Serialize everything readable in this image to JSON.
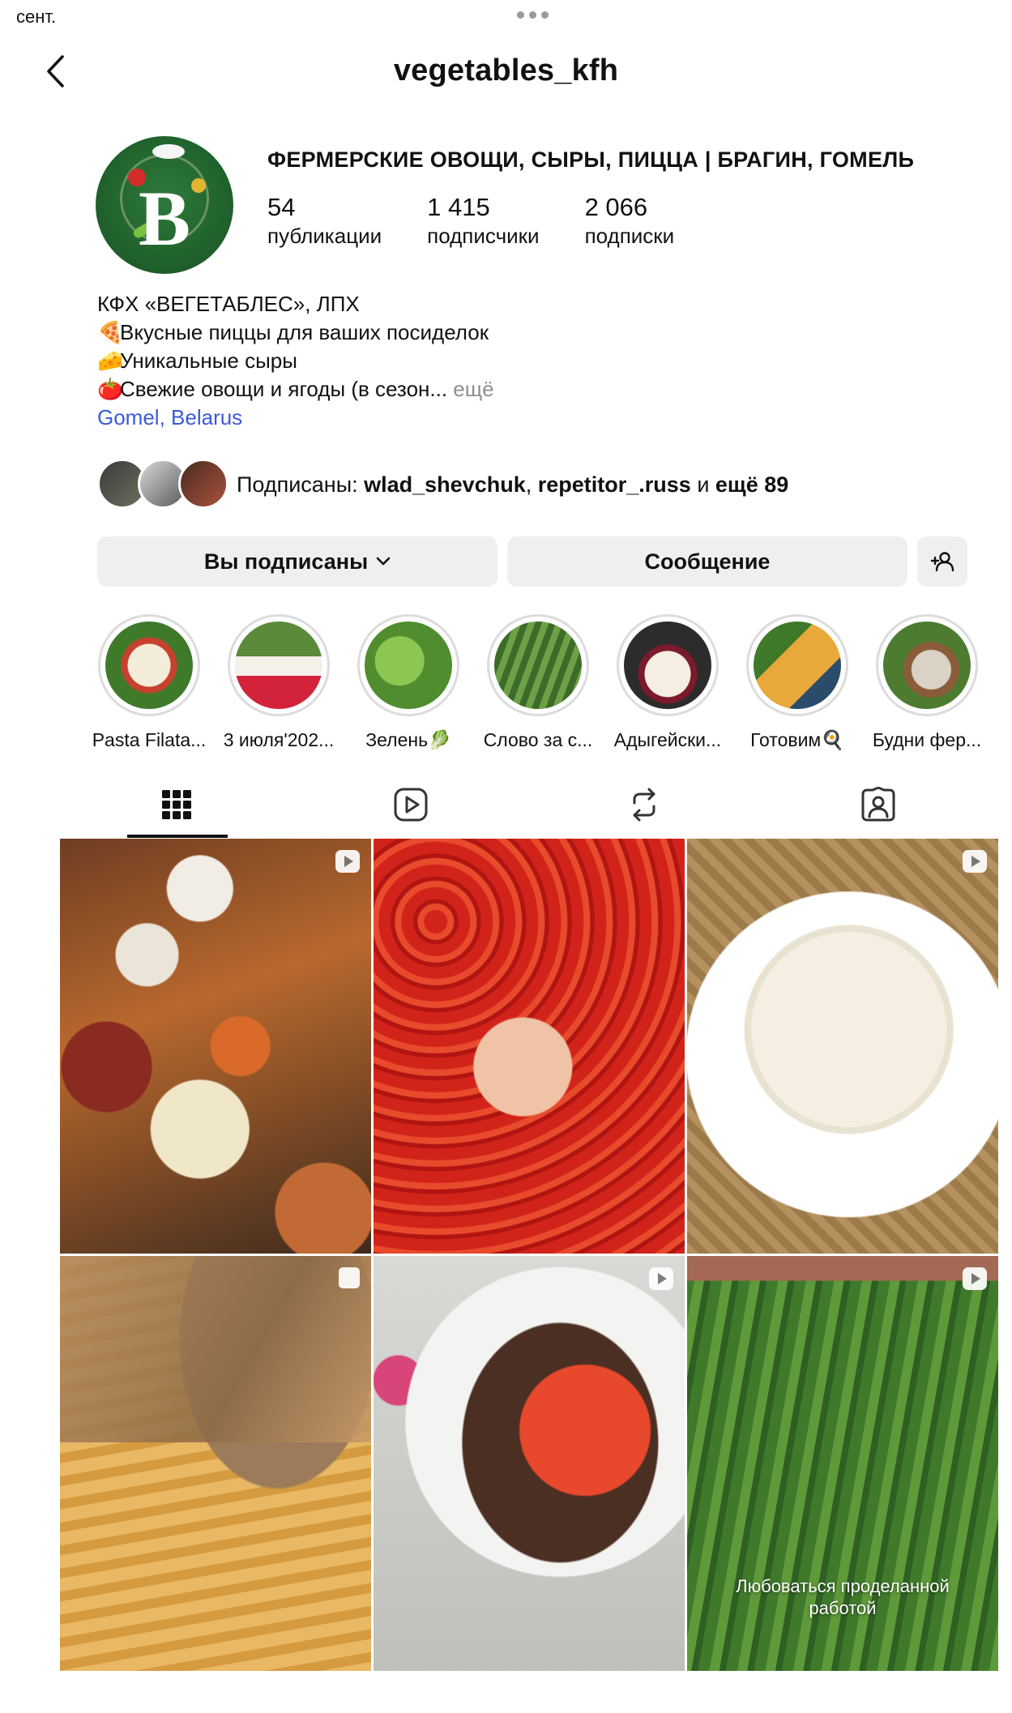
{
  "status_bar": {
    "time": "сент."
  },
  "header": {
    "username": "vegetables_kfh"
  },
  "profile": {
    "full_name": "ФЕРМЕРСКИЕ ОВОЩИ, СЫРЫ, ПИЦЦА | БРАГИН, ГОМЕЛЬ",
    "avatar_letter": "B",
    "stats": [
      {
        "value": "54",
        "label": "публикации"
      },
      {
        "value": "1 415",
        "label": "подписчики"
      },
      {
        "value": "2 066",
        "label": "подписки"
      }
    ],
    "bio": {
      "line1": "КФХ «ВЕГЕТАБЛЕС», ЛПХ",
      "line2_emoji": "🍕",
      "line2": "Вкусные пиццы для ваших посиделок",
      "line3_emoji": "🧀",
      "line3": "Уникальные сыры",
      "line4_emoji": "🍅",
      "line4": "Свежие овощи и ягоды (в сезон...",
      "more": " ещё",
      "location": "Gomel, Belarus"
    },
    "followed_by": {
      "prefix": "Подписаны: ",
      "user1": "wlad_shevchuk",
      "sep": ", ",
      "user2": "repetitor_.russ",
      "and": " и ",
      "rest": "ещё 89"
    }
  },
  "actions": {
    "follow_label": "Вы подписаны",
    "message_label": "Сообщение"
  },
  "highlights": [
    {
      "label": "Pasta Filata..."
    },
    {
      "label": "3 июля'202..."
    },
    {
      "label": "Зелень🥬"
    },
    {
      "label": "Слово за с..."
    },
    {
      "label": "Адыгейски..."
    },
    {
      "label": "Готовим🍳"
    },
    {
      "label": "Будни фер..."
    }
  ],
  "tabs": [
    "grid-icon",
    "reels-icon",
    "repost-icon",
    "tagged-icon"
  ],
  "posts": [
    {
      "type": "reel",
      "caption": ""
    },
    {
      "type": "photo",
      "caption": ""
    },
    {
      "type": "reel",
      "caption": ""
    },
    {
      "type": "carousel",
      "caption": ""
    },
    {
      "type": "reel",
      "caption": ""
    },
    {
      "type": "reel",
      "caption": "Любоваться проделанной\nработой"
    }
  ],
  "colors": {
    "link": "#3b5ad8",
    "button_bg": "#efeff2",
    "muted": "#8e8e8e"
  }
}
